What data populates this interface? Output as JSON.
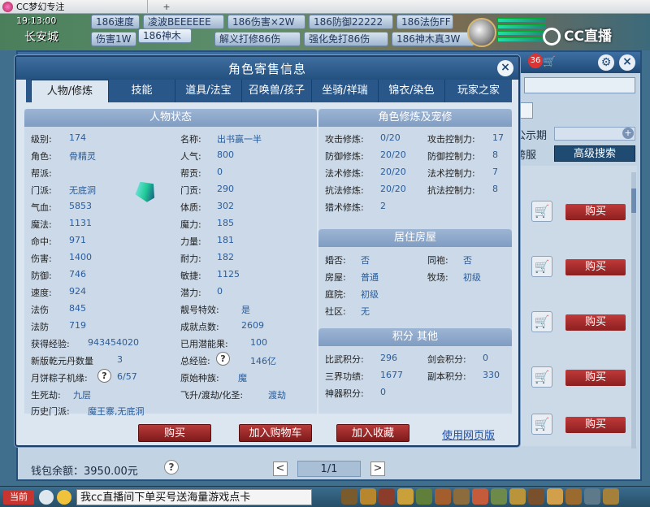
{
  "window": {
    "title": "CC梦幻专注",
    "new_tab": "+"
  },
  "hud": {
    "clock": "19:13:00",
    "city": "长安城",
    "ads": [
      "186速度",
      "凌波BEEEEEE",
      "186伤害×2W",
      "186防御22222",
      "186法伤FF",
      "伤害1W",
      "186神木",
      "解义打修86伤",
      "强化免打86伤",
      "186神木真3W"
    ],
    "cc_logo": "CC直播"
  },
  "market": {
    "cart_badge": "36",
    "cart_icon": "cart-icon",
    "labels": {
      "notice": "公示期",
      "cross": "跨服"
    },
    "advanced_search": "高级搜索",
    "buy_label": "购买",
    "list_rows": 5,
    "wallet": "钱包余额：3950.00元",
    "pager": {
      "current": "1/1",
      "prev": "<",
      "next": ">"
    },
    "help": "?"
  },
  "dialog": {
    "title": "角色寄售信息",
    "tabs": [
      "人物/修炼",
      "技能",
      "道具/法宝",
      "召唤兽/孩子",
      "坐骑/祥瑞",
      "锦衣/染色",
      "玩家之家"
    ],
    "active_tab": 0,
    "status": {
      "heading": "人物状态",
      "left": [
        {
          "k": "级别:",
          "v": "174"
        },
        {
          "k": "角色:",
          "v": "骨精灵"
        },
        {
          "k": "帮派:",
          "v": ""
        },
        {
          "k": "门派:",
          "v": "无底洞"
        },
        {
          "k": "气血:",
          "v": "5853"
        },
        {
          "k": "魔法:",
          "v": "1131"
        },
        {
          "k": "命中:",
          "v": "971"
        },
        {
          "k": "伤害:",
          "v": "1400"
        },
        {
          "k": "防御:",
          "v": "746"
        },
        {
          "k": "速度:",
          "v": "924"
        },
        {
          "k": "法伤",
          "v": "845"
        },
        {
          "k": "法防",
          "v": "719"
        }
      ],
      "right": [
        {
          "k": "名称:",
          "v": "出书赢一半"
        },
        {
          "k": "人气:",
          "v": "800"
        },
        {
          "k": "帮贡:",
          "v": "0"
        },
        {
          "k": "门贡:",
          "v": "290"
        },
        {
          "k": "体质:",
          "v": "302"
        },
        {
          "k": "魔力:",
          "v": "185"
        },
        {
          "k": "力量:",
          "v": "181"
        },
        {
          "k": "耐力:",
          "v": "182"
        },
        {
          "k": "敏捷:",
          "v": "1125"
        },
        {
          "k": "潜力:",
          "v": "0"
        },
        {
          "k": "靓号特效:",
          "v": "是"
        },
        {
          "k": "成就点数:",
          "v": "2609"
        }
      ],
      "extra": {
        "exp_k": "获得经验:",
        "exp_v": "943454020",
        "potential_k": "已用潜能果:",
        "potential_v": "100",
        "dan_k": "新版乾元丹数量",
        "dan_v": "3",
        "total_exp_k": "总经验:",
        "total_exp_v": "146亿",
        "zongzi_k": "月饼粽子机缘:",
        "zongzi_v": "6/57",
        "race_k": "原始种族:",
        "race_v": "魔",
        "lifedeath_k": "生死劫:",
        "lifedeath_v": "九层",
        "fly_k": "飞升/渡劫/化圣:",
        "fly_v": "渡劫",
        "history_k": "历史门派:",
        "history_v": "魔王寨,无底洞"
      }
    },
    "cultivation": {
      "heading": "角色修炼及宠修",
      "rows": [
        {
          "k1": "攻击修炼:",
          "v1": "0/20",
          "k2": "攻击控制力:",
          "v2": "17"
        },
        {
          "k1": "防御修炼:",
          "v1": "20/20",
          "k2": "防御控制力:",
          "v2": "8"
        },
        {
          "k1": "法术修炼:",
          "v1": "20/20",
          "k2": "法术控制力:",
          "v2": "7"
        },
        {
          "k1": "抗法修炼:",
          "v1": "20/20",
          "k2": "抗法控制力:",
          "v2": "8"
        },
        {
          "k1": "猎术修炼:",
          "v1": "2",
          "k2": "",
          "v2": ""
        }
      ]
    },
    "housing": {
      "heading": "居住房屋",
      "rows": [
        {
          "k1": "婚否:",
          "v1": "否",
          "k2": "同袍:",
          "v2": "否"
        },
        {
          "k1": "房屋:",
          "v1": "普通",
          "k2": "牧场:",
          "v2": "初级"
        },
        {
          "k1": "庭院:",
          "v1": "初级",
          "k2": "",
          "v2": ""
        },
        {
          "k1": "社区:",
          "v1": "无",
          "k2": "",
          "v2": ""
        }
      ]
    },
    "points": {
      "heading": "积分 其他",
      "rows": [
        {
          "k1": "比武积分:",
          "v1": "296",
          "k2": "剑会积分:",
          "v2": "0"
        },
        {
          "k1": "三界功绩:",
          "v1": "1677",
          "k2": "副本积分:",
          "v2": "330"
        },
        {
          "k1": "神器积分:",
          "v1": "0",
          "k2": "",
          "v2": ""
        }
      ]
    },
    "buttons": {
      "buy": "购买",
      "add_cart": "加入购物车",
      "favorite": "加入收藏",
      "web": "使用网页版"
    },
    "close": "×"
  },
  "bottom_bar": {
    "current": "当前",
    "chat": "我cc直播间下单买号送海量游戏点卡"
  },
  "colors": {
    "accent": "#23507f",
    "buy": "#b83a3a",
    "value": "#2a5d9a"
  }
}
